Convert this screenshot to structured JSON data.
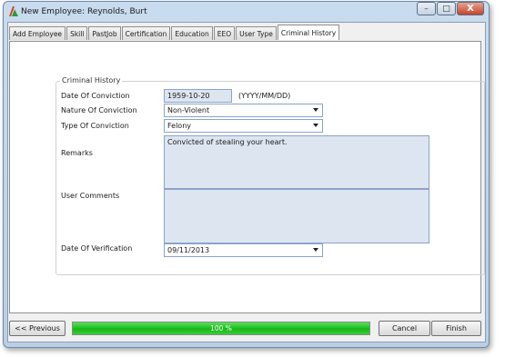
{
  "window": {
    "title": "New Employee: Reynolds, Burt",
    "minimize_icon": "minimize-icon",
    "maximize_icon": "maximize-icon",
    "close_icon": "close-icon",
    "minimize_glyph": "–",
    "maximize_glyph": "□",
    "close_glyph": "X"
  },
  "tabs": [
    {
      "label": "Add Employee",
      "active": false
    },
    {
      "label": "Skill",
      "active": false
    },
    {
      "label": "PastJob",
      "active": false
    },
    {
      "label": "Certification",
      "active": false
    },
    {
      "label": "Education",
      "active": false
    },
    {
      "label": "EEO",
      "active": false
    },
    {
      "label": "User Type",
      "active": false
    },
    {
      "label": "Criminal History",
      "active": true
    }
  ],
  "form": {
    "group_title": "Criminal History",
    "date_of_conviction_label": "Date Of Conviction",
    "date_of_conviction_value": "1959-10-20",
    "date_format_hint": "(YYYY/MM/DD)",
    "nature_label": "Nature Of Conviction",
    "nature_value": "Non-Violent",
    "type_label": "Type Of Conviction",
    "type_value": "Felony",
    "remarks_label": "Remarks",
    "remarks_value": "Convicted of stealing your heart.",
    "user_comments_label": "User Comments",
    "user_comments_value": "",
    "verification_label": "Date Of Verification",
    "verification_value": "09/11/2013"
  },
  "footer": {
    "previous_label": "<< Previous",
    "progress_text": "100 %",
    "progress_fraction": 1.0,
    "cancel_label": "Cancel",
    "finish_label": "Finish"
  },
  "colors": {
    "progress": "#17b817",
    "field_bg": "#dde5f0"
  }
}
